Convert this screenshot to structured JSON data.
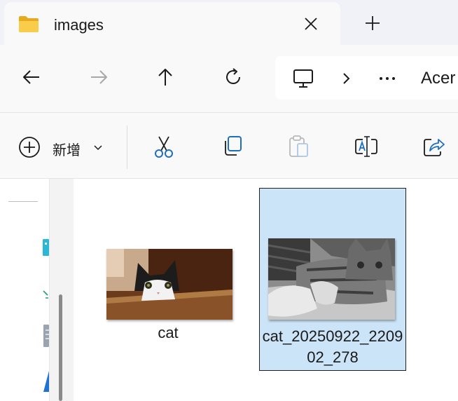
{
  "tab": {
    "title": "images",
    "folder_icon": "folder-icon",
    "close_icon": "close-icon",
    "new_tab_icon": "plus-icon"
  },
  "navigation": {
    "back_icon": "arrow-left-icon",
    "forward_icon": "arrow-right-icon",
    "up_icon": "arrow-up-icon",
    "refresh_icon": "refresh-icon"
  },
  "address_bar": {
    "device_icon": "monitor-icon",
    "separator_icon": "chevron-right-icon",
    "more_icon": "ellipsis-icon",
    "crumb": "Acer"
  },
  "command_bar": {
    "new_label": "新增",
    "new_icon": "circle-plus-icon",
    "new_caret_icon": "chevron-down-icon",
    "cut_icon": "scissors-icon",
    "copy_icon": "copy-icon",
    "paste_icon": "clipboard-icon",
    "rename_icon": "rename-icon",
    "share_icon": "share-icon"
  },
  "files": [
    {
      "name": "cat",
      "selected": false
    },
    {
      "name": "cat_20250922_220902_278",
      "selected": true
    }
  ],
  "colors": {
    "tab_strip": "#f0f2f7",
    "toolbar_bg": "#f9f9f9",
    "selection": "#cce4f7",
    "folder_yellow": "#f4c542",
    "accent_blue": "#1f6fbf"
  }
}
